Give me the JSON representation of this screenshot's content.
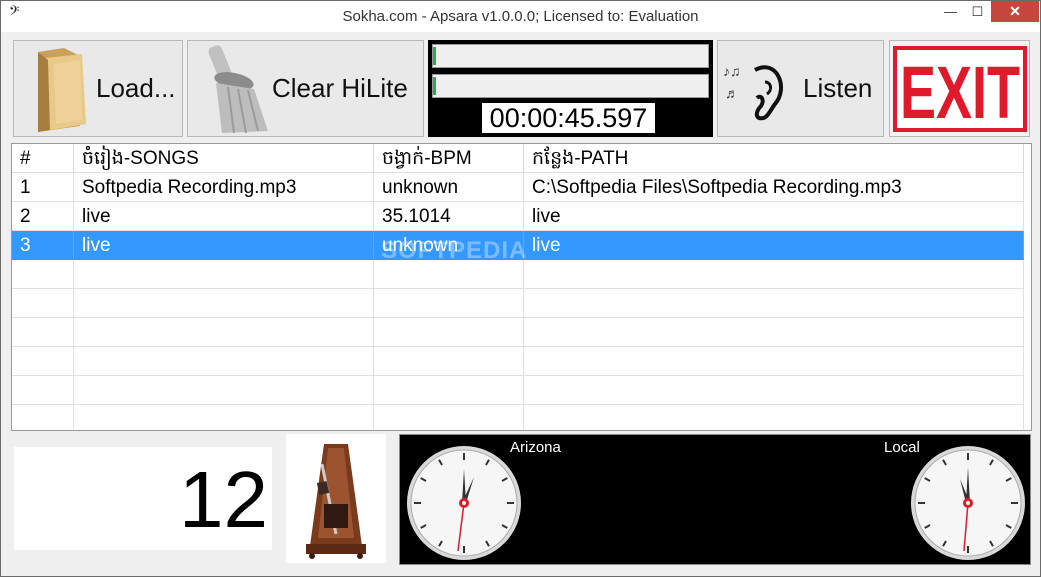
{
  "window": {
    "title": "Sokha.com - Apsara v1.0.0.0; Licensed to: Evaluation",
    "min_label": "—",
    "max_label": "☐",
    "close_label": "✕",
    "app_icon": "𝄢"
  },
  "toolbar": {
    "load_label": "Load...",
    "clear_label": "Clear HiLite",
    "listen_label": "Listen",
    "exit_label": "EXIT",
    "time": "00:00:45.597"
  },
  "grid": {
    "headers": [
      "#",
      "ចំរៀង-SONGS",
      "ចង្វាក់-BPM",
      "កន្លែង-PATH"
    ],
    "rows": [
      [
        "1",
        "Softpedia Recording.mp3",
        "unknown",
        "C:\\Softpedia Files\\Softpedia Recording.mp3"
      ],
      [
        "2",
        "live",
        "35.1014",
        "live"
      ],
      [
        "3",
        "live",
        "unknown",
        "live"
      ]
    ],
    "selected_row": 3,
    "watermark": "SOFTPEDIA"
  },
  "counter": {
    "value": "12"
  },
  "clocks": {
    "left_label": "Arizona",
    "right_label": "Local"
  },
  "colors": {
    "selection": "#3399ff",
    "exit_red": "#e0192b",
    "close_red": "#c7473e",
    "meter_green": "#22b14c"
  }
}
